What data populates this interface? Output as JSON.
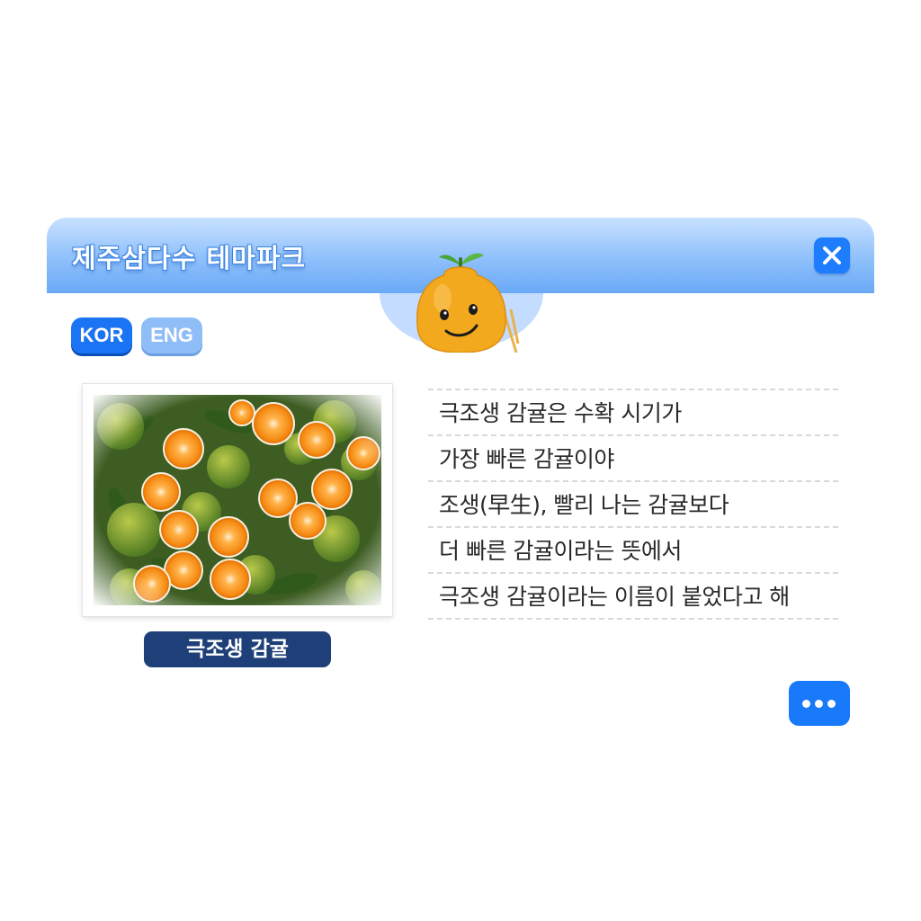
{
  "header": {
    "title": "제주삼다수 테마파크",
    "close_icon": "close-icon"
  },
  "language": {
    "kor_label": "KOR",
    "eng_label": "ENG",
    "selected": "KOR"
  },
  "content": {
    "image_caption": "극조생 감귤",
    "lines": [
      "극조생 감귤은 수확 시기가",
      "가장 빠른 감귤이야",
      "조생(早生), 빨리 나는 감귤보다",
      "더 빠른 감귤이라는 뜻에서",
      "극조생 감귤이라는 이름이 붙었다고 해"
    ]
  },
  "more_icon": "more-dots-icon",
  "colors": {
    "header_top": "#c8e1ff",
    "header_bottom": "#6aa9f6",
    "accent_blue": "#1879fb",
    "caption_bg": "#1e3f78",
    "inactive_lang": "#8fbdf7"
  }
}
